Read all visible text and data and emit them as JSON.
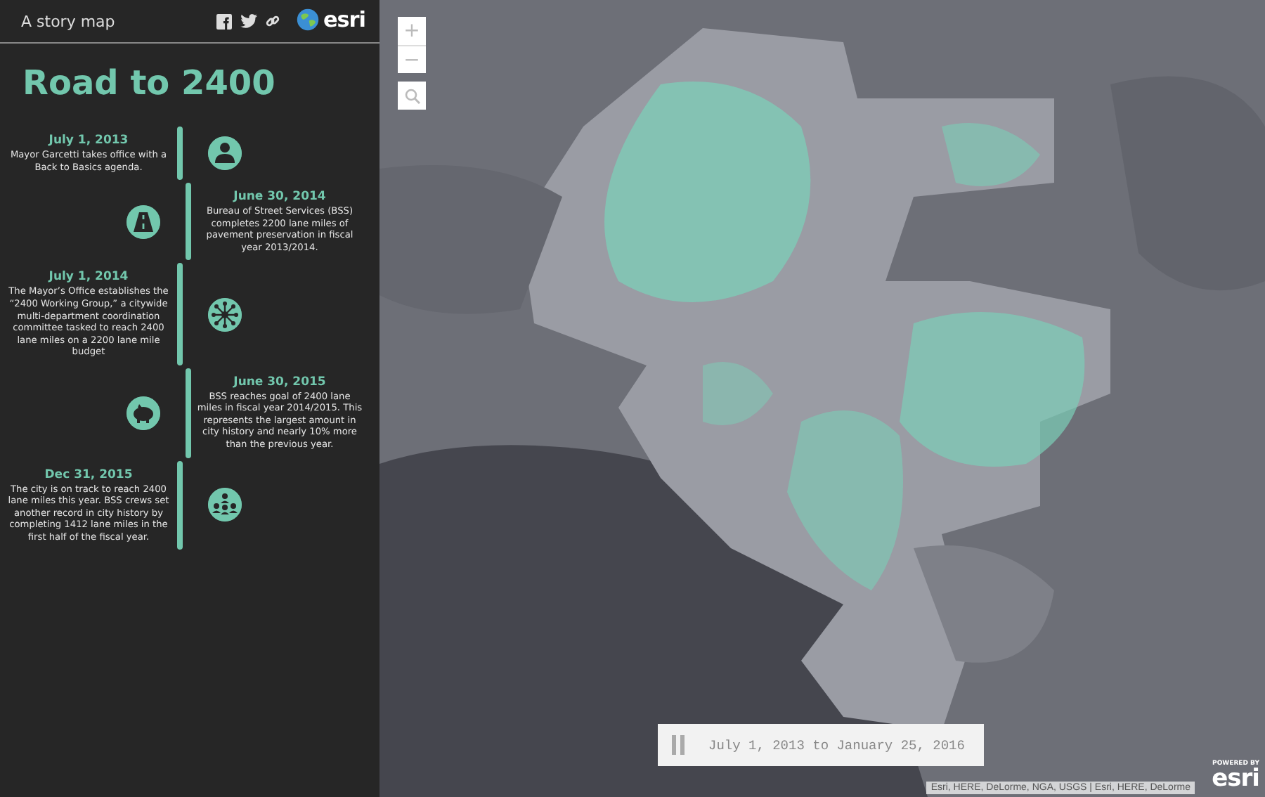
{
  "header": {
    "label": "A story map",
    "brand": "esri"
  },
  "title": "Road to 2400",
  "timeline": [
    {
      "date": "July 1, 2013",
      "text": "Mayor Garcetti takes office with a Back to Basics agenda.",
      "kind": "person"
    },
    {
      "date": "June 30, 2014",
      "text": "Bureau of Street Services (BSS) completes 2200 lane miles of pavement preservation in fiscal year 2013/2014.",
      "kind": "road"
    },
    {
      "date": "July 1, 2014",
      "text": "The Mayor’s Office establishes the “2400 Working Group,” a citywide multi-department coordination committee tasked to reach 2400 lane miles on a 2200 lane mile budget",
      "kind": "network"
    },
    {
      "date": "June 30, 2015",
      "text": "BSS reaches goal of 2400 lane miles in fiscal year 2014/2015. This represents the largest amount in city history and nearly 10% more than the previous year.",
      "kind": "piggybank"
    },
    {
      "date": "Dec 31, 2015",
      "text": "The city is on track to reach 2400 lane miles this year. BSS crews set another record in city history by completing 1412 lane miles in the first half of the fiscal year.",
      "kind": "people"
    }
  ],
  "zoom_controls": [
    "+",
    "−"
  ],
  "time_slider": {
    "playing": true,
    "label": "July 1, 2013 to January 25, 2016"
  },
  "attribution": "Esri, HERE, DeLorme, NGA, USGS | Esri, HERE, DeLorme",
  "powered_by": {
    "label": "POWERED BY",
    "brand": "esri"
  }
}
